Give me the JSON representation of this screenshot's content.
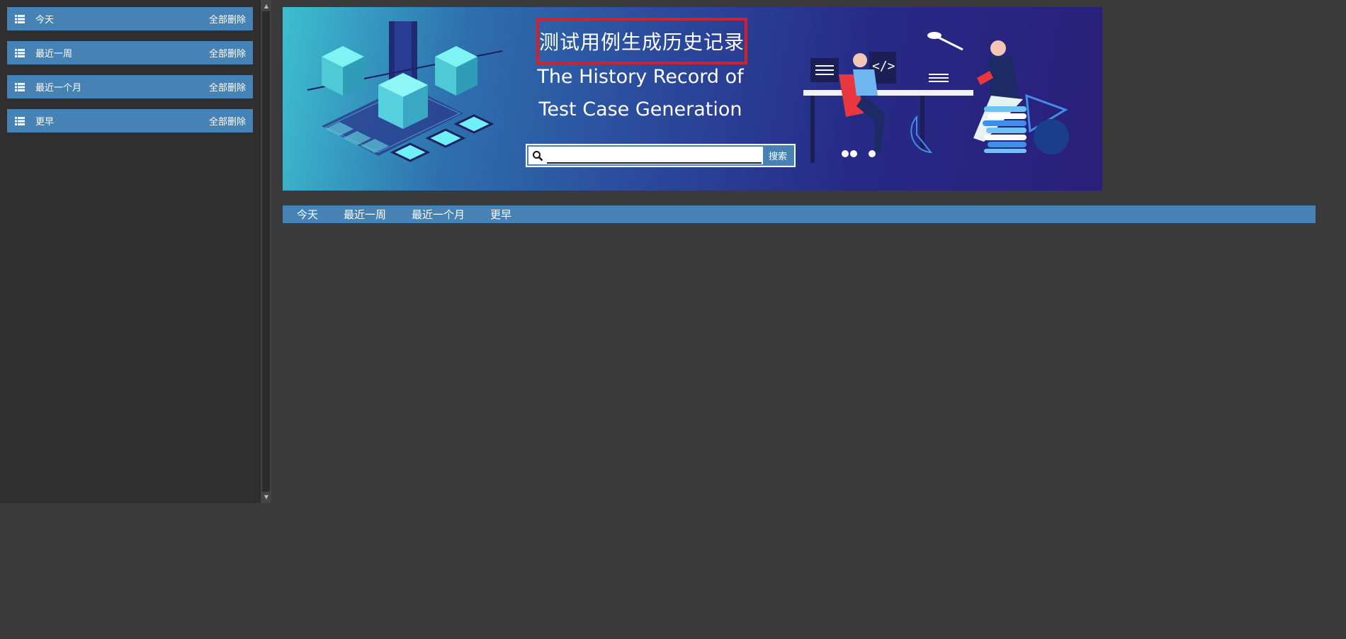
{
  "sidebar": {
    "groups": [
      {
        "label": "今天",
        "action": "全部删除"
      },
      {
        "label": "最近一周",
        "action": "全部删除"
      },
      {
        "label": "最近一个月",
        "action": "全部删除"
      },
      {
        "label": "更早",
        "action": "全部删除"
      }
    ]
  },
  "banner": {
    "title": "测试用例生成历史记录",
    "subtitle_line1": "The History Record of",
    "subtitle_line2": "Test Case Generation",
    "code_glyph": "</>"
  },
  "search": {
    "placeholder": "",
    "value": "",
    "button_label": "搜索",
    "icon": "search-icon"
  },
  "tabs": [
    {
      "label": "今天"
    },
    {
      "label": "最近一周"
    },
    {
      "label": "最近一个月"
    },
    {
      "label": "更早"
    }
  ],
  "colors": {
    "page_bg": "#3a3a3a",
    "sidebar_bg": "#2f2f2f",
    "accent": "#4682b4",
    "title_border": "#d81f26",
    "banner_start": "#3dbfcf",
    "banner_end": "#2a1f7a"
  }
}
